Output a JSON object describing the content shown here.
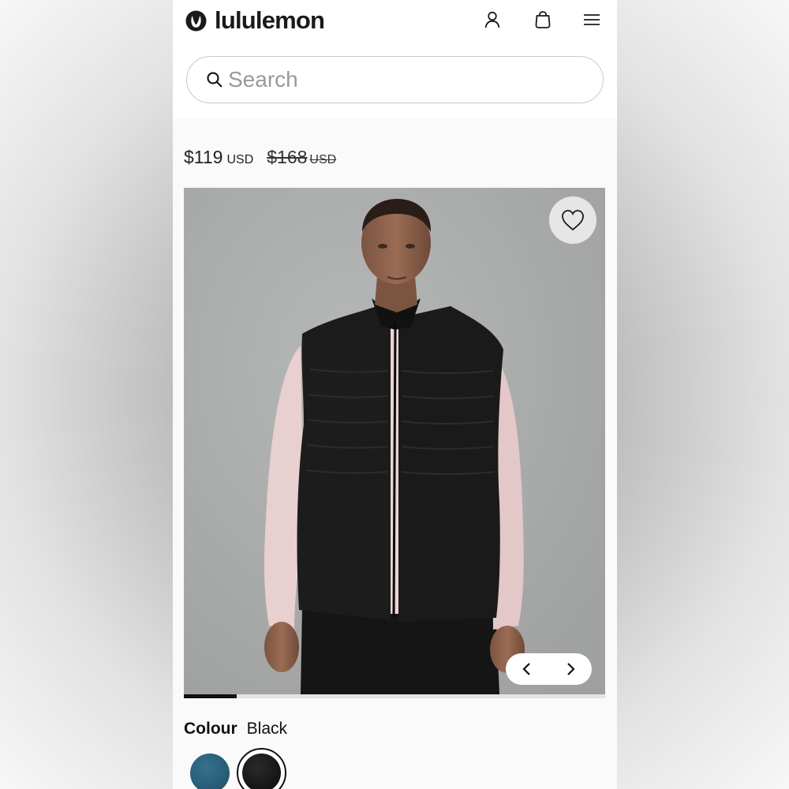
{
  "header": {
    "brand": "lululemon",
    "icons": {
      "account": "user-icon",
      "bag": "shopping-bag-icon",
      "menu": "hamburger-menu-icon"
    }
  },
  "search": {
    "placeholder": "Search",
    "value": ""
  },
  "product": {
    "price_now": "$119",
    "price_now_currency": "USD",
    "price_was": "$168",
    "price_was_currency": "USD",
    "image_progress": 0.125,
    "colour_label": "Colour",
    "colour_value": "Black",
    "swatches": [
      {
        "name": "teal-blue",
        "color": "#2a6280",
        "selected": false
      },
      {
        "name": "black",
        "color": "#111111",
        "selected": true
      }
    ]
  },
  "colors": {
    "text": "#1a1a1a",
    "photo_bg": "#a8aaa9",
    "ink": "#111111"
  }
}
